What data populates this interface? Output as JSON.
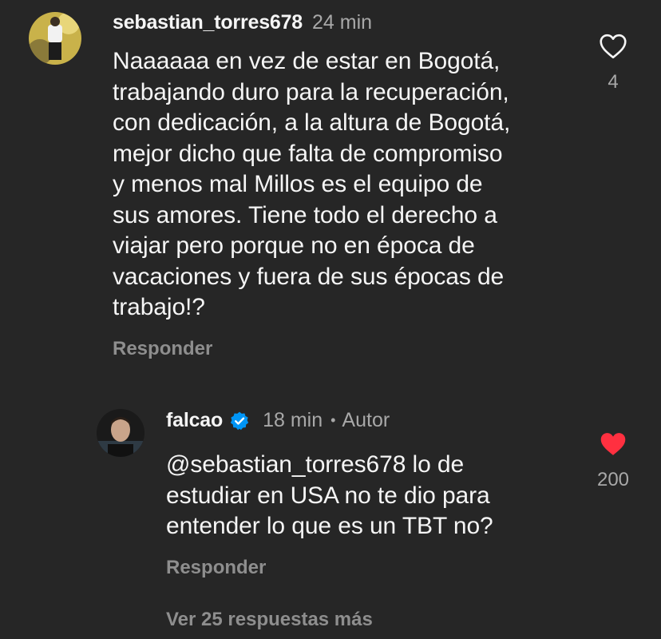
{
  "comments": [
    {
      "username": "sebastian_torres678",
      "time": "24 min",
      "text": "Naaaaaa en vez de estar en Bogotá,\ntrabajando duro para la recuperación,\ncon dedicación, a la altura de Bogotá,\nmejor dicho que falta de compromiso\ny menos mal Millos es el equipo de\nsus amores. Tiene todo el derecho a\nviajar pero porque no en época de\nvacaciones y fuera de sus épocas de\ntrabajo!?",
      "reply_label": "Responder",
      "likes": "4",
      "liked": false,
      "heart_icon": "heart-outline-icon"
    },
    {
      "username": "falcao",
      "verified": true,
      "verified_icon": "verified-badge-icon",
      "time": "18 min",
      "separator": "•",
      "author_tag": "Autor",
      "text": "@sebastian_torres678 lo de\nestudiar en USA no te dio para\nentender lo que es un TBT no?",
      "reply_label": "Responder",
      "likes": "200",
      "liked": true,
      "heart_icon": "heart-filled-icon"
    }
  ],
  "more_replies_label": "Ver 25 respuestas más",
  "colors": {
    "background": "#262626",
    "primary_text": "#f5f5f5",
    "secondary_text": "#a8a8a8",
    "like_red": "#ff3040",
    "verified_blue": "#0095f6"
  }
}
